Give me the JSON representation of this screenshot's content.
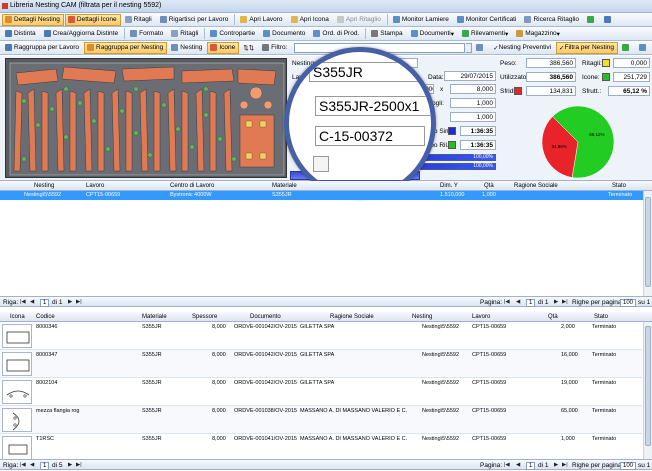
{
  "window": {
    "title": "Libreria Nesting CAM (filtrata per il nesting 5592)"
  },
  "toolbar1": {
    "items": [
      "Dettagli Nesting",
      "Dettagli Icone",
      "Ritagli",
      "Rigartisci per Lavoro",
      "Apri Lavoro",
      "Apri Icona",
      "Apri Ritaglio",
      "Monitor Lamiere",
      "Monitor Certificati",
      "Ricerca Ritaglio"
    ]
  },
  "toolbar2": {
    "items": [
      "Distinta",
      "Crea/Aggiorna Distinte",
      "Formato",
      "Ritagli",
      "Contropartie",
      "Documento",
      "Ord. di Prod.",
      "Stampa",
      "Documenti",
      "Rilevamenti",
      "Magazzino"
    ]
  },
  "toolbar3": {
    "items": [
      "Raggruppa per Lavoro",
      "Raggruppa per Nesting",
      "Nesting",
      "Icone"
    ],
    "filter_label": "Filtro:",
    "right_items": [
      "Nesting Preventivi",
      "Filtra per Nesting"
    ]
  },
  "details": {
    "nesting_label": "Nesting:",
    "nesting_value": "Nesting\\5\\5592",
    "lavoro_label": "Lavoro:",
    "data_label": "Data:",
    "data_value": "29/07/2015",
    "dim_value": "1.510,000",
    "x_label": "x",
    "x_value": "8,000",
    "fogli_label": "Fogli:",
    "fogli_value": "1,000",
    "fogli2_value": "1,000",
    "tempo_sim_label": "Tempo Sim.:",
    "tempo_sim_value": "1:36:35",
    "tempo_ril_label": "Tempo Ril.:",
    "tempo_ril_value": "1:36:35",
    "progress1_label": "100,00%",
    "progress1": 1.0,
    "progress2_label": "100,00%",
    "progress2": 1.0,
    "peso_label": "Peso:",
    "peso_value": "386,560",
    "utilizzato_label": "Utilizzato:",
    "utilizzato_value": "386,560",
    "sfridi_label": "Sfridi:",
    "sfridi_value": "134,831",
    "ritagli_label": "Ritagli:",
    "ritagli_value": "0,000",
    "icone_label": "Icone:",
    "icone_value": "251,729",
    "sfrutt_label": "Sfrutt.:",
    "sfrutt_value": "65,12 %"
  },
  "chart_data": {
    "type": "pie",
    "labels": [
      "65,12%",
      "34,88%"
    ],
    "values": [
      65.12,
      34.88
    ],
    "colors": [
      "#22cc22",
      "#e8242a"
    ]
  },
  "magnifier": {
    "material": "S355JR",
    "spec": "S355JR-2500x1",
    "code": "C-15-00372"
  },
  "nesting_grid": {
    "columns": [
      "Nesting",
      "Lavoro",
      "Centro di Lavoro",
      "Materiale",
      "Dim. Y",
      "Qtà",
      "Ragione Sociale",
      "Stato"
    ],
    "row": {
      "nesting": "Nesting\\5\\5592",
      "lavoro": "CPT15-00659",
      "centro": "Bystronic 4000W",
      "materiale": "S355JR",
      "dimy": "1.510,000",
      "qta": "1,000",
      "ragione": "",
      "stato": "Terminato"
    }
  },
  "pager1": {
    "riga_label": "Riga:",
    "riga_value": "1",
    "of": "di 1",
    "pagina_label": "Pagina:",
    "pagina_value": "1",
    "pagina_of": "di 1",
    "righe_label": "Righe per pagina:",
    "righe_value": "100",
    "righe_of": "su 1"
  },
  "items_grid": {
    "columns": [
      "Icona",
      "Codice",
      "Materiale",
      "Spessore",
      "Documento",
      "Ragione Sociale",
      "Nesting",
      "Lavoro",
      "Qtà",
      "Stato"
    ],
    "rows": [
      {
        "codice": "8000346",
        "materiale": "S355JR",
        "spessore": "8,000",
        "documento": "ORDVE-001042/OV-2015",
        "ragione": "GILETTA SPA",
        "nesting": "Nesting\\5\\5592",
        "lavoro": "CPT15-00659",
        "qta": "2,000",
        "stato": "Terminato"
      },
      {
        "codice": "8000347",
        "materiale": "S355JR",
        "spessore": "8,000",
        "documento": "ORDVE-001042/OV-2015",
        "ragione": "GILETTA SPA",
        "nesting": "Nesting\\5\\5592",
        "lavoro": "CPT15-00659",
        "qta": "16,000",
        "stato": "Terminato"
      },
      {
        "codice": "8002104",
        "materiale": "S355JR",
        "spessore": "8,000",
        "documento": "ORDVE-001042/OV-2015",
        "ragione": "GILETTA SPA",
        "nesting": "Nesting\\5\\5592",
        "lavoro": "CPT15-00659",
        "qta": "19,000",
        "stato": "Terminato"
      },
      {
        "codice": "mezza flangia rog",
        "materiale": "S355JR",
        "spessore": "8,000",
        "documento": "ORDVE-001038/OV-2015",
        "ragione": "MASSANO A. DI MASSANO VALERIO E C.",
        "nesting": "Nesting\\5\\5592",
        "lavoro": "CPT15-00659",
        "qta": "65,000",
        "stato": "Terminato"
      },
      {
        "codice": "T1RSC",
        "materiale": "S355JR",
        "spessore": "8,000",
        "documento": "ORDVE-001041/OV-2015",
        "ragione": "MASSANO A. DI MASSANO VALERIO E C.",
        "nesting": "Nesting\\5\\5592",
        "lavoro": "CPT15-00659",
        "qta": "1,000",
        "stato": "Terminato"
      }
    ]
  },
  "pager2": {
    "riga_label": "Riga:",
    "riga_value": "1",
    "of": "di 5",
    "pagina_label": "Pagina:",
    "pagina_value": "1",
    "pagina_of": "di 1",
    "righe_label": "Righe per pagina:",
    "righe_value": "100",
    "righe_of": "su 1"
  }
}
